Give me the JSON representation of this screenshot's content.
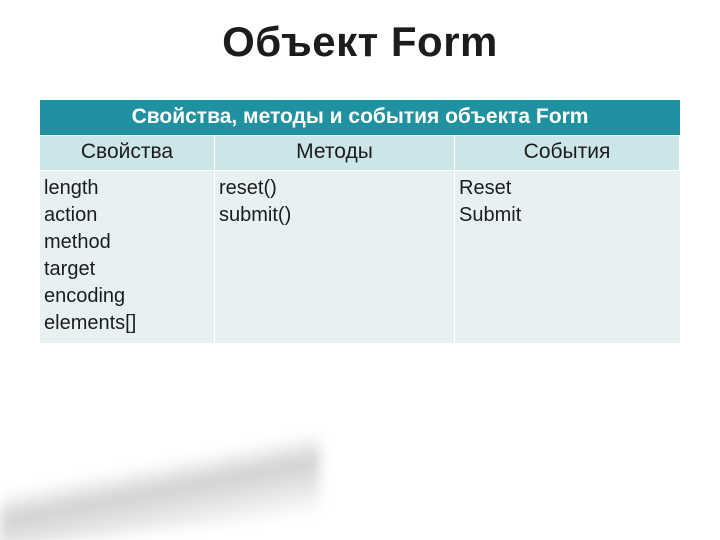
{
  "title": "Объект Form",
  "table": {
    "header": "Свойства, методы и события объекта  Form",
    "columns": {
      "properties": "Свойства",
      "methods": "Методы",
      "events": "События"
    },
    "cells": {
      "properties": "length\n action\n method\n target\n encoding\n elements[]",
      "methods": "reset()\n submit()",
      "events": "Reset\n Submit"
    }
  }
}
